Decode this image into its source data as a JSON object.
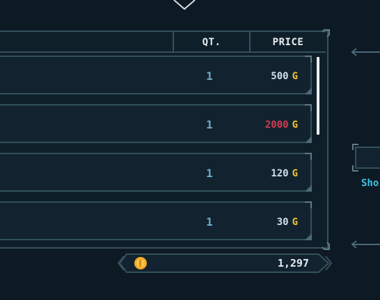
{
  "shop": {
    "columns": {
      "qty": "QT.",
      "price": "PRICE"
    },
    "items": [
      {
        "qty": "1",
        "price": "500",
        "currency": "G",
        "price_color": "#cfe0ea"
      },
      {
        "qty": "1",
        "price": "2000",
        "currency": "G",
        "price_color": "#d23a52"
      },
      {
        "qty": "1",
        "price": "120",
        "currency": "G",
        "price_color": "#cfe0ea"
      },
      {
        "qty": "1",
        "price": "30",
        "currency": "G",
        "price_color": "#cfe0ea"
      }
    ]
  },
  "wallet": {
    "gold": "1,297",
    "icon": "gold-coin-icon"
  },
  "side": {
    "label": "Sho"
  },
  "colors": {
    "background": "#0d1a24",
    "border": "#35505c",
    "accent_cyan": "#3fc4e6",
    "gold": "#f1c232",
    "unaffordable": "#d23a52"
  }
}
